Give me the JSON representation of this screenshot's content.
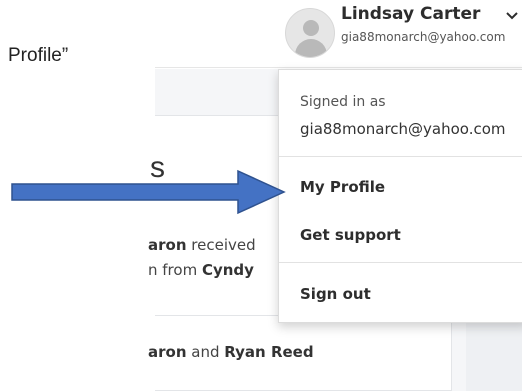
{
  "instruction": {
    "text": "Profile”"
  },
  "header": {
    "user_name": "Lindsay Carter",
    "user_email": "gia88monarch@yahoo.com",
    "avatar_icon": "user-avatar-icon",
    "chevron_icon": "chevron-down-icon"
  },
  "feed": {
    "heading_fragment": "s",
    "notifications": [
      {
        "line1_bold": "aron",
        "line1_rest": " received",
        "line2_rest": "n from ",
        "line2_bold": "Cyndy"
      },
      {
        "line1_bold": "aron",
        "line1_mid": " and ",
        "line1_bold2": "Ryan Reed"
      }
    ]
  },
  "dropdown": {
    "signed_in_label": "Signed in as",
    "signed_in_email": "gia88monarch@yahoo.com",
    "items": [
      {
        "label": "My Profile"
      },
      {
        "label": "Get support"
      },
      {
        "label": "Sign out"
      }
    ]
  },
  "annotation": {
    "arrow_color": "#4472c4",
    "arrow_border": "#2f528f",
    "points_to": "My Profile"
  }
}
